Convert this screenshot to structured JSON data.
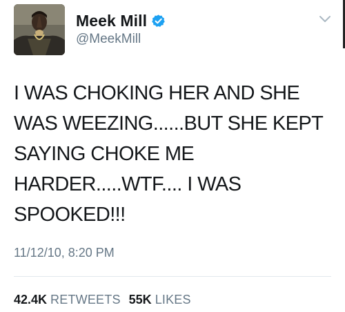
{
  "author": {
    "display_name": "Meek Mill",
    "handle": "@MeekMill",
    "verified": true,
    "avatar_icon": "profile-photo"
  },
  "tweet": {
    "text": "I WAS CHOKING HER AND SHE\nWAS WEEZING......BUT SHE KEPT\nSAYING CHOKE ME\nHARDER.....WTF.... I WAS\nSPOOKED!!!",
    "timestamp": "11/12/10, 8:20 PM"
  },
  "stats": {
    "retweets_count": "42.4K",
    "retweets_label": "RETWEETS",
    "likes_count": "55K",
    "likes_label": "LIKES"
  },
  "icons": {
    "verified": "verified-badge-icon",
    "menu": "chevron-down-icon"
  },
  "colors": {
    "verified_blue": "#1da1f2",
    "secondary_text": "#657786",
    "primary_text": "#14171a",
    "divider": "#e1e8ed"
  }
}
